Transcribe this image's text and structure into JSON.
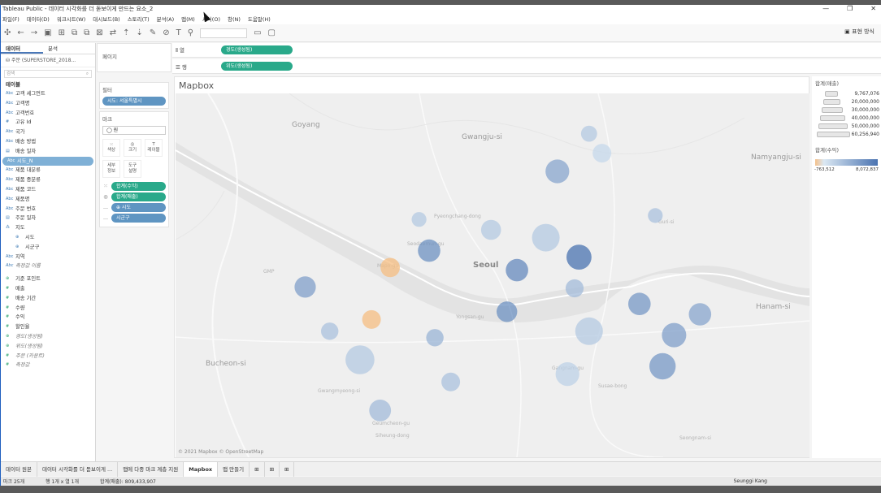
{
  "window": {
    "title": "Tableau Public - 데이터 시각화를 더 돋보이게 만드는 요소_2",
    "controls": [
      "—",
      "❐",
      "✕"
    ]
  },
  "menu": [
    "파일(F)",
    "데이터(D)",
    "워크시트(W)",
    "대시보드(B)",
    "스토리(T)",
    "분석(A)",
    "맵(M)",
    "서식(O)",
    "창(N)",
    "도움말(H)"
  ],
  "toolbar": {
    "icons": [
      "tableau-logo-icon",
      "undo-icon",
      "redo-icon",
      "save-icon",
      "new-datasource-icon",
      "new-sheet-icon",
      "duplicate-icon",
      "clear-icon",
      "swap-icon",
      "sort-asc-icon",
      "sort-desc-icon",
      "highlight-icon",
      "group-icon",
      "label-icon",
      "pin-icon",
      "fit-icon",
      "presentation-icon"
    ],
    "show_me": "표현 방식"
  },
  "data_pane": {
    "tab_data": "데이터",
    "tab_analysis": "분석",
    "datasource": "주문 (SUPERSTORE_2018...",
    "search_placeholder": "검색",
    "tables_header": "테이블",
    "fields": [
      {
        "icon": "Abc",
        "name": "고객 세그먼트",
        "type": "dim"
      },
      {
        "icon": "Abc",
        "name": "고객명",
        "type": "dim"
      },
      {
        "icon": "Abc",
        "name": "고객번호",
        "type": "dim"
      },
      {
        "icon": "#",
        "name": "고유 Id",
        "type": "dim"
      },
      {
        "icon": "Abc",
        "name": "국가",
        "type": "dim"
      },
      {
        "icon": "Abc",
        "name": "배송 방법",
        "type": "dim"
      },
      {
        "icon": "▤",
        "name": "배송 일자",
        "type": "dim"
      },
      {
        "icon": "Abc",
        "name": "시도_N",
        "type": "dim",
        "selected": true
      },
      {
        "icon": "Abc",
        "name": "제품 대분류",
        "type": "dim"
      },
      {
        "icon": "Abc",
        "name": "제품 중분류",
        "type": "dim"
      },
      {
        "icon": "Abc",
        "name": "제품 코드",
        "type": "dim"
      },
      {
        "icon": "Abc",
        "name": "제품명",
        "type": "dim"
      },
      {
        "icon": "Abc",
        "name": "주문 번호",
        "type": "dim"
      },
      {
        "icon": "▤",
        "name": "주문 일자",
        "type": "dim"
      },
      {
        "icon": "⁂",
        "name": "지도",
        "type": "dim"
      },
      {
        "icon": "⊕",
        "name": "시도",
        "type": "dim",
        "indent": true
      },
      {
        "icon": "⊕",
        "name": "시군구",
        "type": "dim",
        "indent": true
      },
      {
        "icon": "Abc",
        "name": "지역",
        "type": "dim"
      },
      {
        "icon": "Abc",
        "name": "측정값 이름",
        "type": "dim",
        "italic": true
      },
      {
        "icon": "⊕",
        "name": "기준 포인트",
        "type": "meas"
      },
      {
        "icon": "#",
        "name": "매출",
        "type": "meas"
      },
      {
        "icon": "#",
        "name": "배송 기간",
        "type": "meas"
      },
      {
        "icon": "#",
        "name": "수량",
        "type": "meas"
      },
      {
        "icon": "#",
        "name": "수익",
        "type": "meas"
      },
      {
        "icon": "#",
        "name": "할인율",
        "type": "meas"
      },
      {
        "icon": "⊕",
        "name": "경도(생성됨)",
        "type": "meas",
        "italic": true
      },
      {
        "icon": "⊕",
        "name": "위도(생성됨)",
        "type": "meas",
        "italic": true
      },
      {
        "icon": "#",
        "name": "주문 (카운트)",
        "type": "meas",
        "italic": true
      },
      {
        "icon": "#",
        "name": "측정값",
        "type": "meas",
        "italic": true
      }
    ]
  },
  "pages": {
    "title": "페이지"
  },
  "filters": {
    "title": "필터",
    "pill": "시도: 서울특별시"
  },
  "marks": {
    "title": "마크",
    "type": "◯ 원",
    "buttons": [
      {
        "icon": "⁙",
        "label": "색상"
      },
      {
        "icon": "◎",
        "label": "크기"
      },
      {
        "icon": "T",
        "label": "레이블"
      },
      {
        "icon": "",
        "label": "세부\n정보"
      },
      {
        "icon": "",
        "label": "도구\n설명"
      }
    ],
    "pills": [
      {
        "icon": "⁙",
        "label": "합계(수익)",
        "color": "g"
      },
      {
        "icon": "◎",
        "label": "합계(매출)",
        "color": "g"
      },
      {
        "icon": "…",
        "label": "⊕ 시도",
        "color": "b"
      },
      {
        "icon": "…",
        "label": "시군구",
        "color": "b"
      }
    ]
  },
  "shelves": {
    "columns_label": "열",
    "columns_pill": "경도(생성됨)",
    "rows_label": "행",
    "rows_pill": "위도(생성됨)"
  },
  "sheet": {
    "title": "Mapbox",
    "copyright": "© 2021 Mapbox © OpenStreetMap"
  },
  "map_labels": [
    {
      "text": "Goyang",
      "style": "n"
    },
    {
      "text": "Gwangju-si",
      "style": "n"
    },
    {
      "text": "Namyangju-si",
      "style": "n"
    },
    {
      "text": "Seoul",
      "style": "b"
    },
    {
      "text": "Mapo-gu",
      "style": "sm"
    },
    {
      "text": "Seodaemun-gu",
      "style": "sm"
    },
    {
      "text": "Pyeongchang-dong",
      "style": "sm"
    },
    {
      "text": "Guri-si",
      "style": "sm"
    },
    {
      "text": "GMP",
      "style": "sm"
    },
    {
      "text": "Yongsan-gu",
      "style": "sm"
    },
    {
      "text": "Hanam-si",
      "style": "n"
    },
    {
      "text": "Bucheon-si",
      "style": "n"
    },
    {
      "text": "Gwangmyeong-si",
      "style": "sm"
    },
    {
      "text": "Gangnam-gu",
      "style": "sm"
    },
    {
      "text": "Geumcheon-gu",
      "style": "sm"
    },
    {
      "text": "Siheung-dong",
      "style": "sm"
    },
    {
      "text": "Susae-bong",
      "style": "sm"
    },
    {
      "text": "Seongnam-si",
      "style": "sm"
    }
  ],
  "legend": {
    "size_title": "합계(매출)",
    "size_values": [
      "9,767,076",
      "20,000,000",
      "30,000,000",
      "40,000,000",
      "50,000,000",
      "60,256,940"
    ],
    "color_title": "합계(수익)",
    "color_min": "-763,512",
    "color_max": "8,072,837"
  },
  "chart_data": {
    "type": "scatter",
    "x_label": "경도(생성됨)",
    "y_label": "위도(생성됨)",
    "size_measure": "합계(매출)",
    "color_measure": "합계(수익)",
    "points": [
      {
        "district": "Gangseo",
        "x": 126.85,
        "y": 37.551,
        "sales": 20000000,
        "profit": 5000000
      },
      {
        "district": "Mapo",
        "x": 126.909,
        "y": 37.566,
        "sales": 17000000,
        "profit": -500000
      },
      {
        "district": "Yangcheon",
        "x": 126.867,
        "y": 37.517,
        "sales": 14000000,
        "profit": 2500000
      },
      {
        "district": "Yeongdeungpo",
        "x": 126.896,
        "y": 37.526,
        "sales": 16000000,
        "profit": -600000
      },
      {
        "district": "Guro",
        "x": 126.888,
        "y": 37.495,
        "sales": 32000000,
        "profit": 2000000
      },
      {
        "district": "Geumcheon",
        "x": 126.902,
        "y": 37.456,
        "sales": 21000000,
        "profit": 3000000
      },
      {
        "district": "Gwanak",
        "x": 126.951,
        "y": 37.478,
        "sales": 16000000,
        "profit": 2500000
      },
      {
        "district": "Dongjak",
        "x": 126.94,
        "y": 37.512,
        "sales": 14000000,
        "profit": 3500000
      },
      {
        "district": "Eunpyeong",
        "x": 126.929,
        "y": 37.603,
        "sales": 10000000,
        "profit": 2000000
      },
      {
        "district": "Seodaemun",
        "x": 126.936,
        "y": 37.579,
        "sales": 22000000,
        "profit": 6000000
      },
      {
        "district": "Jongno",
        "x": 126.979,
        "y": 37.595,
        "sales": 18000000,
        "profit": 2000000
      },
      {
        "district": "Jung",
        "x": 126.997,
        "y": 37.564,
        "sales": 22000000,
        "profit": 6500000
      },
      {
        "district": "Yongsan",
        "x": 126.99,
        "y": 37.532,
        "sales": 19000000,
        "profit": 6000000
      },
      {
        "district": "Seocho",
        "x": 127.032,
        "y": 37.484,
        "sales": 24000000,
        "profit": 1500000
      },
      {
        "district": "Gangnam",
        "x": 127.047,
        "y": 37.517,
        "sales": 30000000,
        "profit": 2000000
      },
      {
        "district": "Seongbuk",
        "x": 127.017,
        "y": 37.589,
        "sales": 30000000,
        "profit": 2000000
      },
      {
        "district": "Gangbuk",
        "x": 127.025,
        "y": 37.64,
        "sales": 24000000,
        "profit": 4500000
      },
      {
        "district": "Dobong",
        "x": 127.047,
        "y": 37.669,
        "sales": 12000000,
        "profit": 2000000
      },
      {
        "district": "Nowon",
        "x": 127.056,
        "y": 37.654,
        "sales": 16000000,
        "profit": 1000000
      },
      {
        "district": "Dongdaemun",
        "x": 127.04,
        "y": 37.574,
        "sales": 26000000,
        "profit": 8072837
      },
      {
        "district": "Seongdong",
        "x": 127.037,
        "y": 37.55,
        "sales": 15000000,
        "profit": 3000000
      },
      {
        "district": "Jungnang",
        "x": 127.093,
        "y": 37.606,
        "sales": 10000000,
        "profit": 2500000
      },
      {
        "district": "Gwangjin",
        "x": 127.082,
        "y": 37.538,
        "sales": 22000000,
        "profit": 5500000
      },
      {
        "district": "Songpa",
        "x": 127.106,
        "y": 37.514,
        "sales": 25000000,
        "profit": 5000000
      },
      {
        "district": "Gangdong",
        "x": 127.124,
        "y": 37.53,
        "sales": 22000000,
        "profit": 4500000
      },
      {
        "district": "Suseo",
        "x": 127.098,
        "y": 37.49,
        "sales": 28000000,
        "profit": 5500000
      }
    ]
  },
  "tabs": [
    "데이터 원본",
    "데이터 시각화를 더 돋보이게 ...",
    "맵에 다중 마크 계층 지원",
    "Mapbox",
    "맵 만들기"
  ],
  "status": {
    "marks": "마크 25개",
    "rows": "행 1개 x 열 1개",
    "sum": "합계(매출): 809,433,907",
    "user": "Seunggi Kang"
  }
}
